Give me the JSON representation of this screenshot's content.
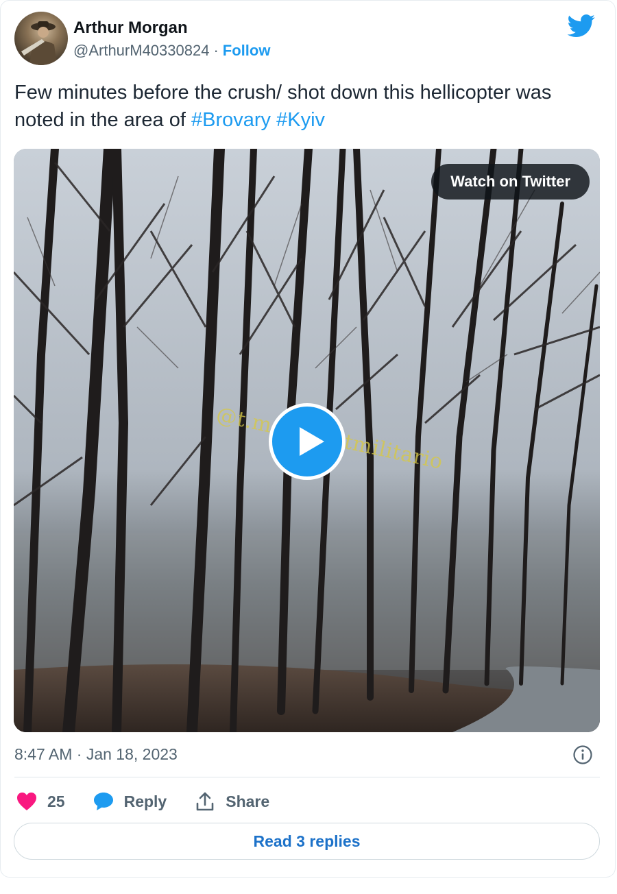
{
  "author": {
    "display_name": "Arthur Morgan",
    "handle": "@ArthurM40330824",
    "separator": "·",
    "follow_label": "Follow"
  },
  "tweet": {
    "text_prefix": "Few minutes before the crush/ shot down this hellicopter was noted in the area of ",
    "hashtags": [
      "#Brovary",
      "#Kyiv"
    ]
  },
  "media": {
    "watch_label": "Watch on Twitter",
    "watermark": "@t.me/infantmilitario"
  },
  "meta": {
    "timestamp": "8:47 AM · Jan 18, 2023"
  },
  "actions": {
    "like_count": "25",
    "reply_label": "Reply",
    "share_label": "Share"
  },
  "replies_button_label": "Read 3 replies",
  "colors": {
    "accent": "#1d9bf0",
    "like": "#f91880",
    "text": "#0f1419",
    "muted": "#536471"
  },
  "icons": {
    "brand": "twitter-bird-icon",
    "play": "play-icon",
    "info": "info-icon",
    "like": "heart-icon",
    "reply": "speech-bubble-icon",
    "share": "share-upload-icon"
  }
}
